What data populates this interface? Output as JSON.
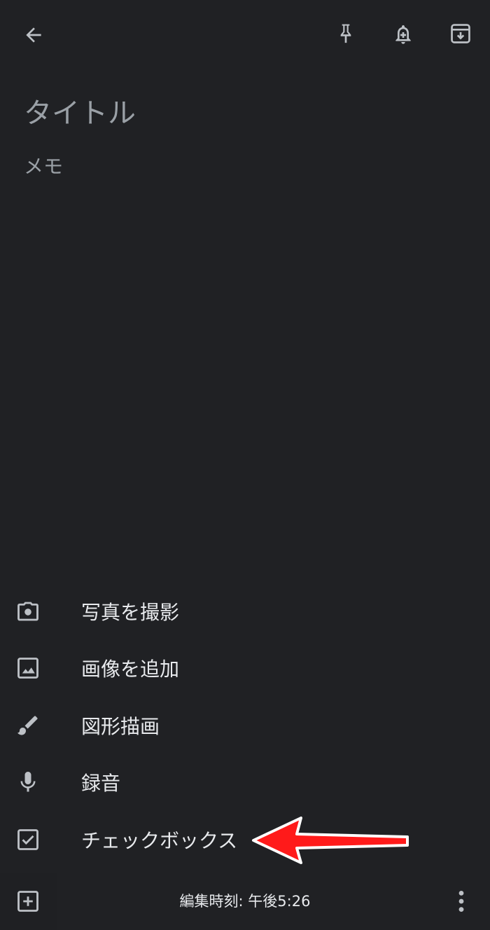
{
  "note": {
    "title_placeholder": "タイトル",
    "body_placeholder": "メモ"
  },
  "toolbar": {
    "icons": [
      "back-arrow-icon",
      "pin-icon",
      "reminder-bell-icon",
      "archive-icon"
    ]
  },
  "add_menu": {
    "items": [
      {
        "label": "写真を撮影",
        "icon": "camera-icon"
      },
      {
        "label": "画像を追加",
        "icon": "image-icon"
      },
      {
        "label": "図形描画",
        "icon": "brush-icon"
      },
      {
        "label": "録音",
        "icon": "microphone-icon"
      },
      {
        "label": "チェックボックス",
        "icon": "checkbox-icon"
      }
    ]
  },
  "annotation": {
    "arrow_color": "#ff1a1a"
  },
  "footer": {
    "edited_text": "編集時刻: 午後5:26",
    "icons": [
      "add-box-icon",
      "more-vert-icon"
    ]
  },
  "colors": {
    "background": "#202124",
    "text_primary": "#e8eaed",
    "text_hint": "#9aa0a6",
    "icon": "#bdc1c6"
  }
}
